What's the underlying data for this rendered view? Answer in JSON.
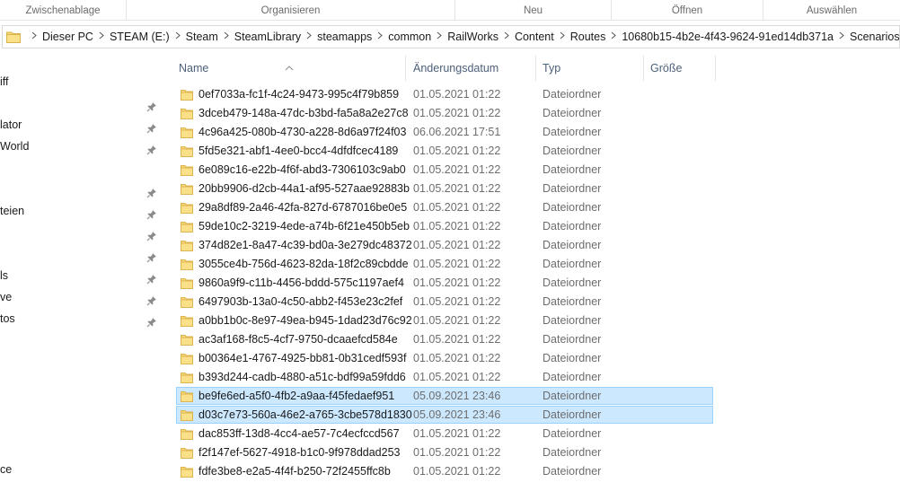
{
  "ribbon": {
    "groups": [
      "Zwischenablage",
      "Organisieren",
      "Neu",
      "Öffnen",
      "Auswählen"
    ]
  },
  "address": {
    "breadcrumb": [
      "Dieser PC",
      "STEAM (E:)",
      "Steam",
      "SteamLibrary",
      "steamapps",
      "common",
      "RailWorks",
      "Content",
      "Routes",
      "10680b15-4b2e-4f43-9624-91ed14db371a",
      "Scenarios"
    ]
  },
  "nav": {
    "items": [
      {
        "label": "iff",
        "pinned": false
      },
      {
        "label": "lator",
        "pinned": true
      },
      {
        "label": "World",
        "pinned": true
      },
      {
        "label": "",
        "pinned": true
      },
      {
        "label": "teien",
        "pinned": true
      },
      {
        "label": "",
        "pinned": true
      },
      {
        "label": "",
        "pinned": true
      },
      {
        "label": "ls",
        "pinned": true
      },
      {
        "label": "ve",
        "pinned": true
      },
      {
        "label": "tos",
        "pinned": true
      },
      {
        "label": "",
        "pinned": true
      },
      {
        "label": "ce",
        "pinned": false
      }
    ]
  },
  "columns": {
    "name": "Name",
    "date": "Änderungsdatum",
    "type": "Typ",
    "size": "Größe"
  },
  "files": [
    {
      "name": "0ef7033a-fc1f-4c24-9473-995c4f79b859",
      "date": "01.05.2021 01:22",
      "type": "Dateiordner",
      "selected": false
    },
    {
      "name": "3dceb479-148a-47dc-b3bd-fa5a8a2e27c8",
      "date": "01.05.2021 01:22",
      "type": "Dateiordner",
      "selected": false
    },
    {
      "name": "4c96a425-080b-4730-a228-8d6a97f24f03",
      "date": "06.06.2021 17:51",
      "type": "Dateiordner",
      "selected": false
    },
    {
      "name": "5fd5e321-abf1-4ee0-bcc4-4dfdfcec4189",
      "date": "01.05.2021 01:22",
      "type": "Dateiordner",
      "selected": false
    },
    {
      "name": "6e089c16-e22b-4f6f-abd3-7306103c9ab0",
      "date": "01.05.2021 01:22",
      "type": "Dateiordner",
      "selected": false
    },
    {
      "name": "20bb9906-d2cb-44a1-af95-527aae92883b",
      "date": "01.05.2021 01:22",
      "type": "Dateiordner",
      "selected": false
    },
    {
      "name": "29a8df89-2a46-42fa-827d-6787016be0e5",
      "date": "01.05.2021 01:22",
      "type": "Dateiordner",
      "selected": false
    },
    {
      "name": "59de10c2-3219-4ede-a74b-6f21e450b5eb",
      "date": "01.05.2021 01:22",
      "type": "Dateiordner",
      "selected": false
    },
    {
      "name": "374d82e1-8a47-4c39-bd0a-3e279dc48372",
      "date": "01.05.2021 01:22",
      "type": "Dateiordner",
      "selected": false
    },
    {
      "name": "3055ce4b-756d-4623-82da-18f2c89cbdde",
      "date": "01.05.2021 01:22",
      "type": "Dateiordner",
      "selected": false
    },
    {
      "name": "9860a9f9-c11b-4456-bddd-575c1197aef4",
      "date": "01.05.2021 01:22",
      "type": "Dateiordner",
      "selected": false
    },
    {
      "name": "6497903b-13a0-4c50-abb2-f453e23c2fef",
      "date": "01.05.2021 01:22",
      "type": "Dateiordner",
      "selected": false
    },
    {
      "name": "a0bb1b0c-8e97-49ea-b945-1dad23d76c92",
      "date": "01.05.2021 01:22",
      "type": "Dateiordner",
      "selected": false
    },
    {
      "name": "ac3af168-f8c5-4cf7-9750-dcaaefcd584e",
      "date": "01.05.2021 01:22",
      "type": "Dateiordner",
      "selected": false
    },
    {
      "name": "b00364e1-4767-4925-bb81-0b31cedf593f",
      "date": "01.05.2021 01:22",
      "type": "Dateiordner",
      "selected": false
    },
    {
      "name": "b393d244-cadb-4880-a51c-bdf99a59fdd6",
      "date": "01.05.2021 01:22",
      "type": "Dateiordner",
      "selected": false
    },
    {
      "name": "be9fe6ed-a5f0-4fb2-a9aa-f45fedaef951",
      "date": "05.09.2021 23:46",
      "type": "Dateiordner",
      "selected": true
    },
    {
      "name": "d03c7e73-560a-46e2-a765-3cbe578d1830",
      "date": "05.09.2021 23:46",
      "type": "Dateiordner",
      "selected": true
    },
    {
      "name": "dac853ff-13d8-4cc4-ae57-7c4ecfccd567",
      "date": "01.05.2021 01:22",
      "type": "Dateiordner",
      "selected": false
    },
    {
      "name": "f2f147ef-5627-4918-b1c0-9f978ddad253",
      "date": "01.05.2021 01:22",
      "type": "Dateiordner",
      "selected": false
    },
    {
      "name": "fdfe3be8-e2a5-4f4f-b250-72f2455ffc8b",
      "date": "01.05.2021 01:22",
      "type": "Dateiordner",
      "selected": false
    }
  ],
  "colors": {
    "selection_bg": "#cce8ff",
    "selection_border": "#99d1ff",
    "folder_yellow": "#f8d775",
    "header_text": "#4c607a"
  },
  "icons": {
    "folder": "folder-icon",
    "pin": "pin-icon",
    "separator": "chevron-right-icon",
    "sort": "sort-up-icon"
  }
}
